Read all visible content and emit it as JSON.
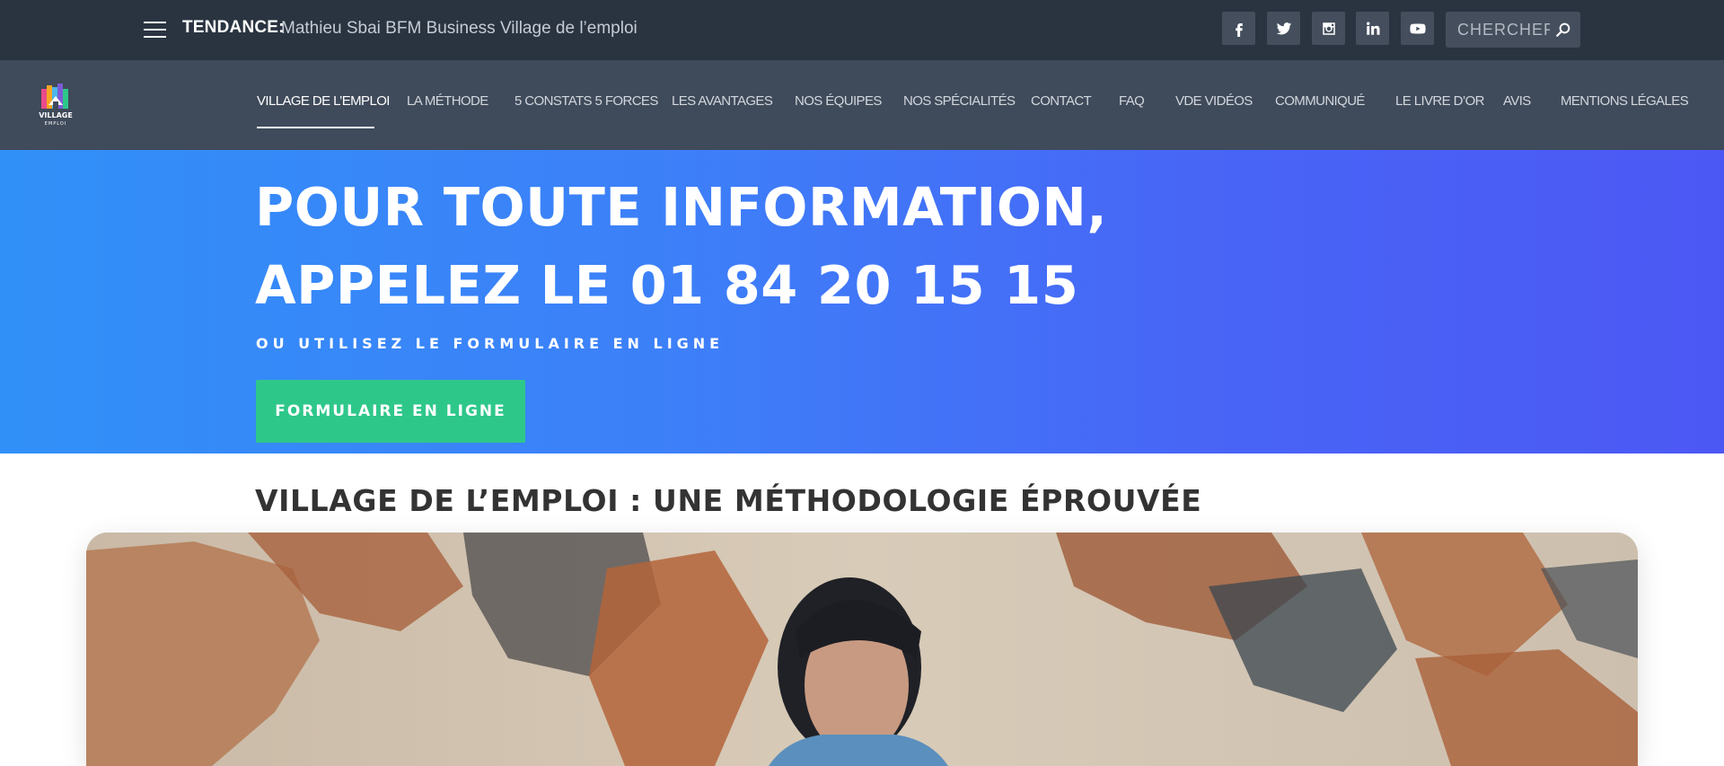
{
  "topbar": {
    "trend_label": "TENDANCE:",
    "trend_text": "Mathieu Sbai BFM Business Village de l’emploi",
    "social_icons": [
      "facebook-icon",
      "twitter-icon",
      "instagram-icon",
      "linkedin-icon",
      "youtube-icon"
    ],
    "search_placeholder": "CHERCHER"
  },
  "nav": {
    "logo_text": "VILLAGE",
    "logo_subtext": "EMPLOI",
    "active_index": 0,
    "items": [
      {
        "label": "VILLAGE DE L’EMPLOI"
      },
      {
        "label": "LA MÉTHODE"
      },
      {
        "label": "5 CONSTATS 5 FORCES"
      },
      {
        "label": "LES AVANTAGES"
      },
      {
        "label": "NOS ÉQUIPES"
      },
      {
        "label": "NOS SPÉCIALITÉS"
      },
      {
        "label": "CONTACT"
      },
      {
        "label": "FAQ"
      },
      {
        "label": "VDE VIDÉOS"
      },
      {
        "label": "COMMUNIQUÉ"
      },
      {
        "label": "LE LIVRE D’OR"
      },
      {
        "label": "AVIS"
      },
      {
        "label": "MENTIONS LÉGALES"
      }
    ]
  },
  "hero": {
    "title_line1": "POUR TOUTE INFORMATION,",
    "title_line2": "APPELEZ LE 01 84 20 15 15",
    "subtitle": "OU UTILISEZ LE FORMULAIRE EN LIGNE",
    "button_label": "FORMULAIRE EN LIGNE"
  },
  "section": {
    "title": "VILLAGE DE L’EMPLOI : UNE MÉTHODOLOGIE ÉPROUVÉE"
  },
  "colors": {
    "topbar_bg": "#2a3441",
    "navbar_bg": "#3f4a5a",
    "hero_gradient_start": "#3190f8",
    "hero_gradient_end": "#4c58f4",
    "cta_green": "#2ec78a"
  }
}
